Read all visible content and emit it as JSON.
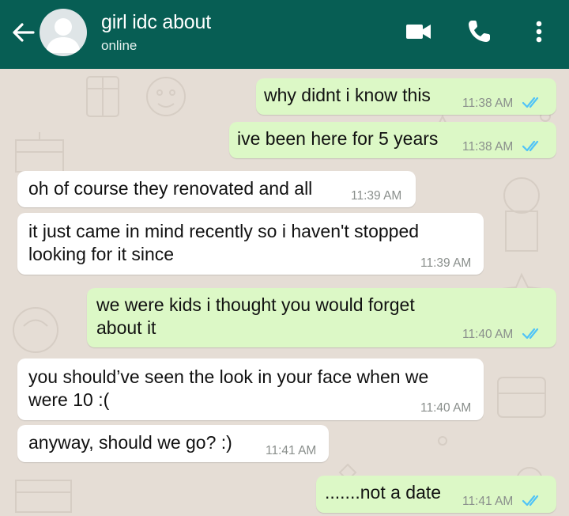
{
  "header": {
    "contact_name": "girl idc about",
    "status": "online",
    "icons": [
      "back-arrow-icon",
      "avatar-placeholder-icon",
      "video-call-icon",
      "voice-call-icon",
      "more-options-icon"
    ],
    "colors": {
      "bar": "#075e54",
      "outgoing_bubble": "#dcf8c6",
      "incoming_bubble": "#ffffff",
      "read_ticks": "#4fc3f7",
      "chat_background": "#e5ddd5"
    }
  },
  "messages": [
    {
      "direction": "out",
      "text": "why didnt i know this",
      "time": "11:38 AM",
      "status": "read"
    },
    {
      "direction": "out",
      "text": "ive been here for 5 years",
      "time": "11:38 AM",
      "status": "read"
    },
    {
      "direction": "in",
      "text": "oh of course they renovated and all",
      "time": "11:39 AM"
    },
    {
      "direction": "in",
      "text": "it just came in mind recently so i haven't stopped\nlooking for it since",
      "time": "11:39 AM"
    },
    {
      "direction": "out",
      "text": "we were kids i thought you would forget\nabout it",
      "time": "11:40 AM",
      "status": "read"
    },
    {
      "direction": "in",
      "text": "you should’ve seen the look in your face when we\nwere 10 :(",
      "time": "11:40 AM"
    },
    {
      "direction": "in",
      "text": "anyway, should we go? :)",
      "time": "11:41 AM"
    },
    {
      "direction": "out",
      "text": ".......not a date",
      "time": "11:41 AM",
      "status": "read"
    }
  ]
}
